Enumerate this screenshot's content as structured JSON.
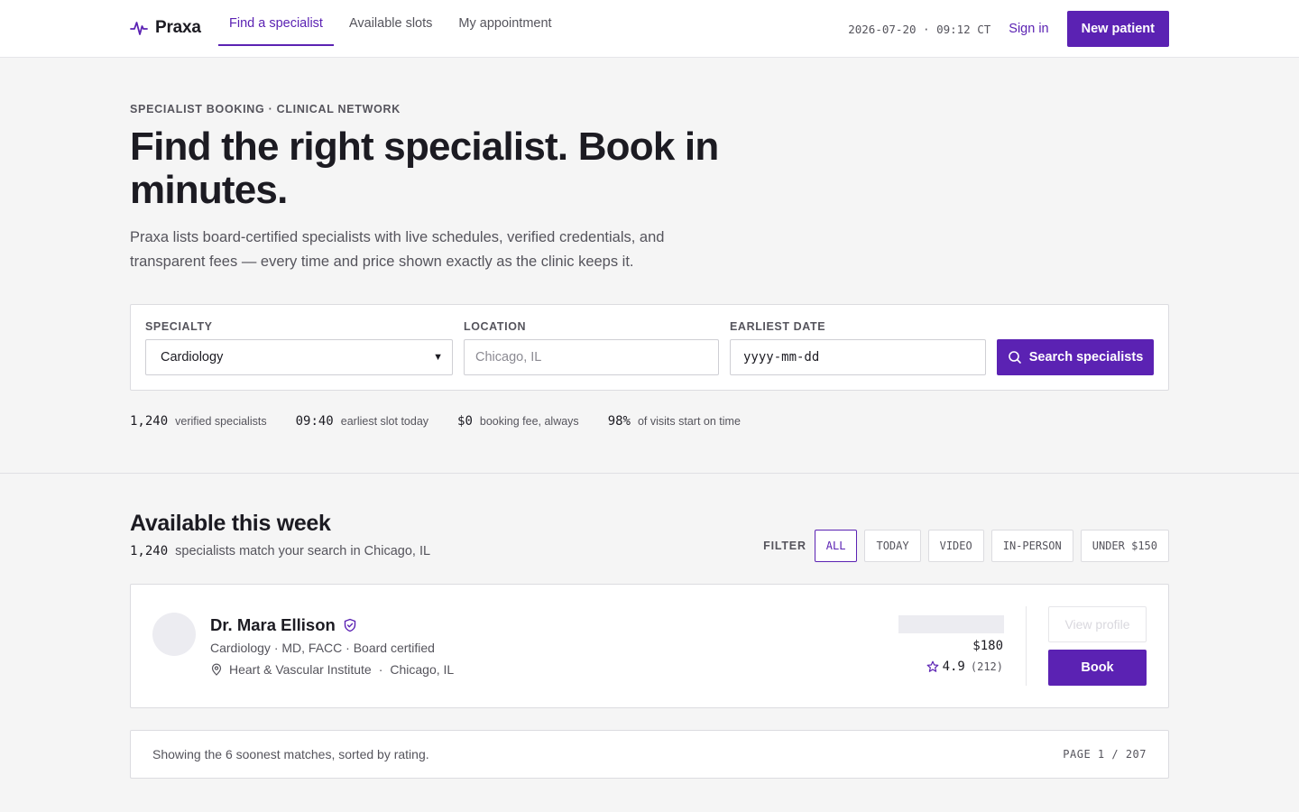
{
  "colors": {
    "accent": "#5b22b3",
    "text": "#1c1b22",
    "muted": "#55545c",
    "surface": "#f5f5f5"
  },
  "nav": {
    "brand": "Praxa",
    "brand_icon": "pulse-icon",
    "links": [
      {
        "label": "Find a specialist",
        "active": true
      },
      {
        "label": "Available slots",
        "active": false
      },
      {
        "label": "My appointment",
        "active": false
      }
    ],
    "clock": "2026-07-20 · 09:12 CT",
    "signin_label": "Sign in",
    "cta_label": "New patient"
  },
  "hero": {
    "eyebrow": "SPECIALIST BOOKING · CLINICAL NETWORK",
    "headline": "Find the right specialist. Book in minutes.",
    "lede": "Praxa lists board-certified specialists with live schedules, verified credentials, and transparent fees — every time and price shown exactly as the clinic keeps it."
  },
  "search": {
    "specialty_label": "SPECIALTY",
    "specialty_value": "Cardiology",
    "location_label": "LOCATION",
    "location_placeholder": "Chicago, IL",
    "date_label": "EARLIEST DATE",
    "date_placeholder": "yyyy-mm-dd",
    "button_label": "Search specialists",
    "button_icon": "search-icon"
  },
  "stats": [
    {
      "value": "1,240",
      "label": "verified specialists"
    },
    {
      "value": "09:40",
      "label": "earliest slot today"
    },
    {
      "value": "$0",
      "label": "booking fee, always"
    },
    {
      "value": "98%",
      "label": "of visits start on time"
    }
  ],
  "results": {
    "title": "Available this week",
    "count": "1,240",
    "subtitle": "specialists match your search in Chicago, IL",
    "filter_label": "FILTER",
    "filters": [
      {
        "label": "ALL",
        "active": true
      },
      {
        "label": "TODAY",
        "active": false
      },
      {
        "label": "VIDEO",
        "active": false
      },
      {
        "label": "IN-PERSON",
        "active": false
      },
      {
        "label": "UNDER $150",
        "active": false
      }
    ]
  },
  "doctor": {
    "name": "Dr. Mara Ellison",
    "verified_icon": "verified-shield-icon",
    "meta": "Cardiology · MD, FACC · Board certified",
    "clinic": "Heart & Vascular Institute",
    "city": "Chicago, IL",
    "price": "$180",
    "rating": "4.9",
    "reviews": "(212)",
    "view_label": "View profile",
    "book_label": "Book"
  },
  "footer": {
    "text": "Showing the 6 soonest matches, sorted by rating.",
    "page": "PAGE 1 / 207"
  }
}
